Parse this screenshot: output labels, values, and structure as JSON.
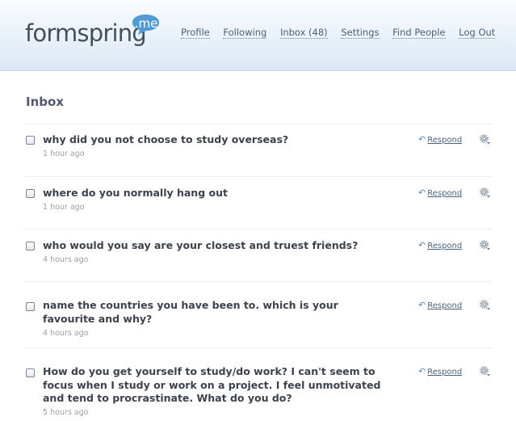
{
  "brand": {
    "name": "formspring",
    "bubble_text": ".me",
    "bubble_color": "#4f9bd5"
  },
  "nav": {
    "items": [
      "Profile",
      "Following",
      "Inbox (48)",
      "Settings",
      "Find People",
      "Log Out"
    ]
  },
  "page": {
    "title": "Inbox"
  },
  "inbox": {
    "respond_label": "Respond",
    "items": [
      {
        "question": "why did you not choose to study overseas?",
        "time": "1 hour ago"
      },
      {
        "question": "where do you normally hang out",
        "time": "1 hour ago"
      },
      {
        "question": "who would you say are your closest and truest friends?",
        "time": "4 hours ago"
      },
      {
        "question": "name the countries you have been to. which is your favourite and why?",
        "time": "4 hours ago"
      },
      {
        "question": "How do you get yourself to study/do work? I can't seem to focus when I study or work on a project. I feel unmotivated and tend to procrastinate. What do you do?",
        "time": "5 hours ago"
      }
    ]
  },
  "icons": {
    "checkbox": "checkbox-icon",
    "respond": "reply-arrow-icon",
    "options": "gear-icon"
  }
}
